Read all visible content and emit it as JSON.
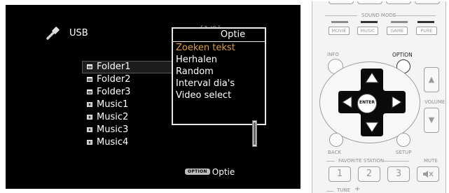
{
  "screen": {
    "source_label": "USB",
    "counter": "[1/9]",
    "items": [
      {
        "type": "folder",
        "label": "Folder1",
        "selected": true
      },
      {
        "type": "folder",
        "label": "Folder2",
        "selected": false
      },
      {
        "type": "folder",
        "label": "Folder3",
        "selected": false
      },
      {
        "type": "music",
        "label": "Music1",
        "selected": false
      },
      {
        "type": "music",
        "label": "Music2",
        "selected": false
      },
      {
        "type": "music",
        "label": "Music3",
        "selected": false
      },
      {
        "type": "music",
        "label": "Music4",
        "selected": false
      }
    ],
    "option_menu": {
      "title": "Optie",
      "items": [
        "Zoeken tekst",
        "Herhalen",
        "Random",
        "Interval dia's",
        "Video select"
      ],
      "active_index": 0
    },
    "hint": {
      "badge": "OPTION",
      "text": "Optie"
    },
    "colors": {
      "highlight": "#d89c47",
      "background": "#000000",
      "text": "#ffffff"
    }
  },
  "remote": {
    "sound_mode_label": "SOUND MODE",
    "sound_mode_buttons": [
      "MOVIE",
      "MUSIC",
      "GAME",
      "PURE"
    ],
    "info_label": "INFO",
    "option_label": "OPTION",
    "enter_label": "ENTER",
    "volume_label": "VOLUME",
    "back_label": "BACK",
    "setup_label": "SETUP",
    "favorite_label": "FAVORITE STATION",
    "mute_label": "MUTE",
    "favorite_buttons": [
      "1",
      "2",
      "3"
    ],
    "tune_label": "TUNE"
  }
}
